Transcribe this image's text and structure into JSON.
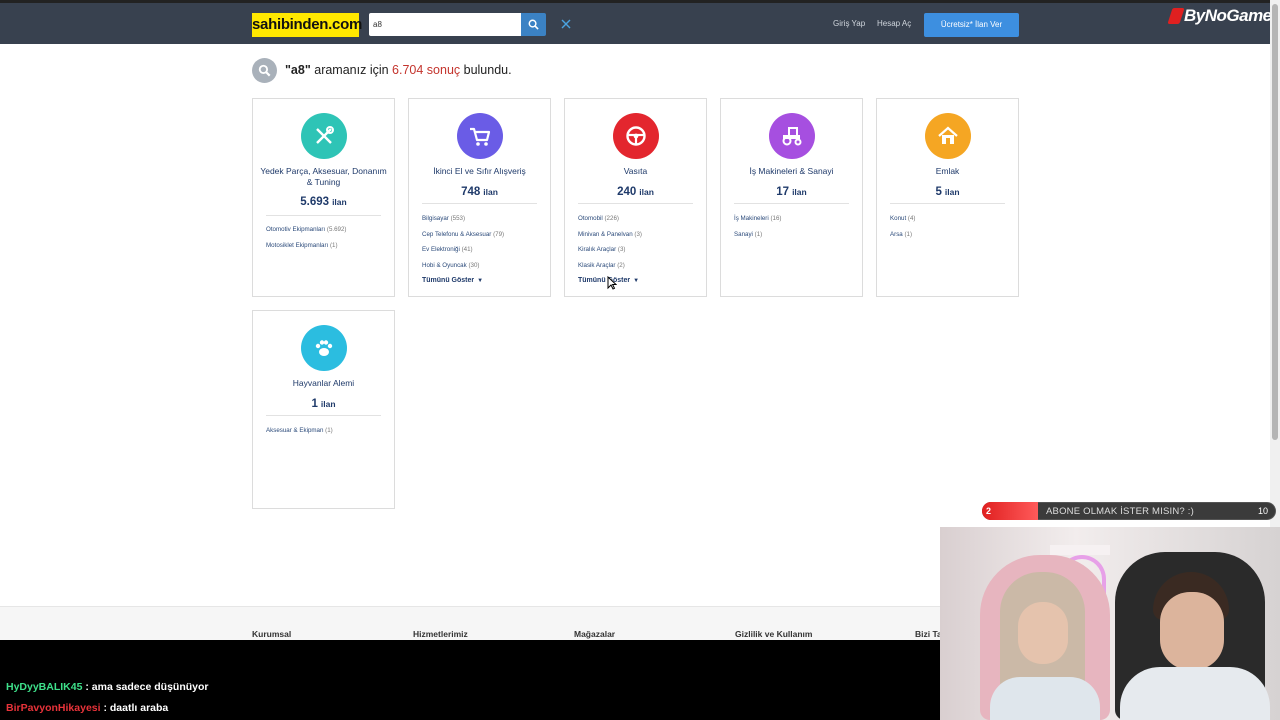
{
  "header": {
    "logo": "sahibinden.com",
    "search_value": "a8",
    "login": "Giriş Yap",
    "register": "Hesap Aç",
    "post_ad": "Ücretsiz* İlan Ver",
    "brand_watermark": "ByNoGame"
  },
  "results": {
    "query": "\"a8\"",
    "middle": " aramanız için ",
    "count": "6.704 sonuç",
    "suffix": " bulundu."
  },
  "unit": "ilan",
  "categories": [
    {
      "title": "Yedek Parça, Aksesuar, Donanım & Tuning",
      "count": "5.693",
      "color": "#2ec4b6",
      "icon": "tools-icon",
      "items": [
        {
          "label": "Otomotiv Ekipmanları",
          "count": "(5.692)"
        },
        {
          "label": "Motosiklet Ekipmanları",
          "count": "(1)"
        }
      ],
      "show_all": ""
    },
    {
      "title": "İkinci El ve Sıfır Alışveriş",
      "count": "748",
      "color": "#6a5ce6",
      "icon": "cart-icon",
      "items": [
        {
          "label": "Bilgisayar",
          "count": "(553)"
        },
        {
          "label": "Cep Telefonu & Aksesuar",
          "count": "(79)"
        },
        {
          "label": "Ev Elektroniği",
          "count": "(41)"
        },
        {
          "label": "Hobi & Oyuncak",
          "count": "(30)"
        }
      ],
      "show_all": "Tümünü Göster"
    },
    {
      "title": "Vasıta",
      "count": "240",
      "color": "#e3262e",
      "icon": "steering-wheel-icon",
      "items": [
        {
          "label": "Otomobil",
          "count": "(226)"
        },
        {
          "label": "Minivan & Panelvan",
          "count": "(3)"
        },
        {
          "label": "Kiralık Araçlar",
          "count": "(3)"
        },
        {
          "label": "Klasik Araçlar",
          "count": "(2)"
        }
      ],
      "show_all": "Tümünü Göster"
    },
    {
      "title": "İş Makineleri & Sanayi",
      "count": "17",
      "color": "#a64fe0",
      "icon": "tractor-icon",
      "items": [
        {
          "label": "İş Makineleri",
          "count": "(16)"
        },
        {
          "label": "Sanayi",
          "count": "(1)"
        }
      ],
      "show_all": ""
    },
    {
      "title": "Emlak",
      "count": "5",
      "color": "#f5a623",
      "icon": "home-icon",
      "items": [
        {
          "label": "Konut",
          "count": "(4)"
        },
        {
          "label": "Arsa",
          "count": "(1)"
        }
      ],
      "show_all": ""
    },
    {
      "title": "Hayvanlar Alemi",
      "count": "1",
      "color": "#2bbde0",
      "icon": "paw-icon",
      "items": [
        {
          "label": "Aksesuar & Ekipman",
          "count": "(1)"
        }
      ],
      "show_all": ""
    }
  ],
  "footer": {
    "links": [
      "Kurumsal",
      "Hizmetlerimiz",
      "Mağazalar",
      "Gizlilik ve Kullanım",
      "Bizi Ta"
    ]
  },
  "chat": [
    {
      "user": "HyDyyBALIK45",
      "user_color": "#3ee08a",
      "text": " : ama sadece düşünüyor"
    },
    {
      "user": "BirPavyonHikayesi",
      "user_color": "#e8333a",
      "text": " : daatlı araba"
    }
  ],
  "subscribe": {
    "current": "2",
    "text": "ABONE OLMAK İSTER MISIN? :)",
    "goal": "10"
  }
}
